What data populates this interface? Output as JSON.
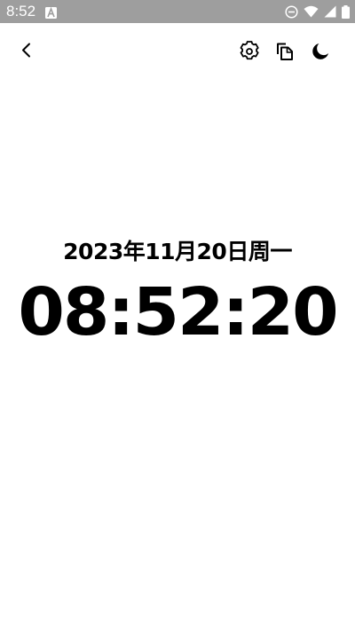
{
  "status_bar": {
    "time": "8:52",
    "background_color": "#9e9e9e",
    "icons": [
      "font-a-icon",
      "do-not-disturb-icon",
      "wifi-icon",
      "cellular-signal-icon",
      "battery-icon"
    ]
  },
  "toolbar": {
    "icons": [
      "back-arrow-icon",
      "settings-icon",
      "copy-icon",
      "night-mode-icon"
    ]
  },
  "clock": {
    "date": "2023年11月20日周一",
    "time": "08:52:20",
    "text_color": "#000000"
  }
}
